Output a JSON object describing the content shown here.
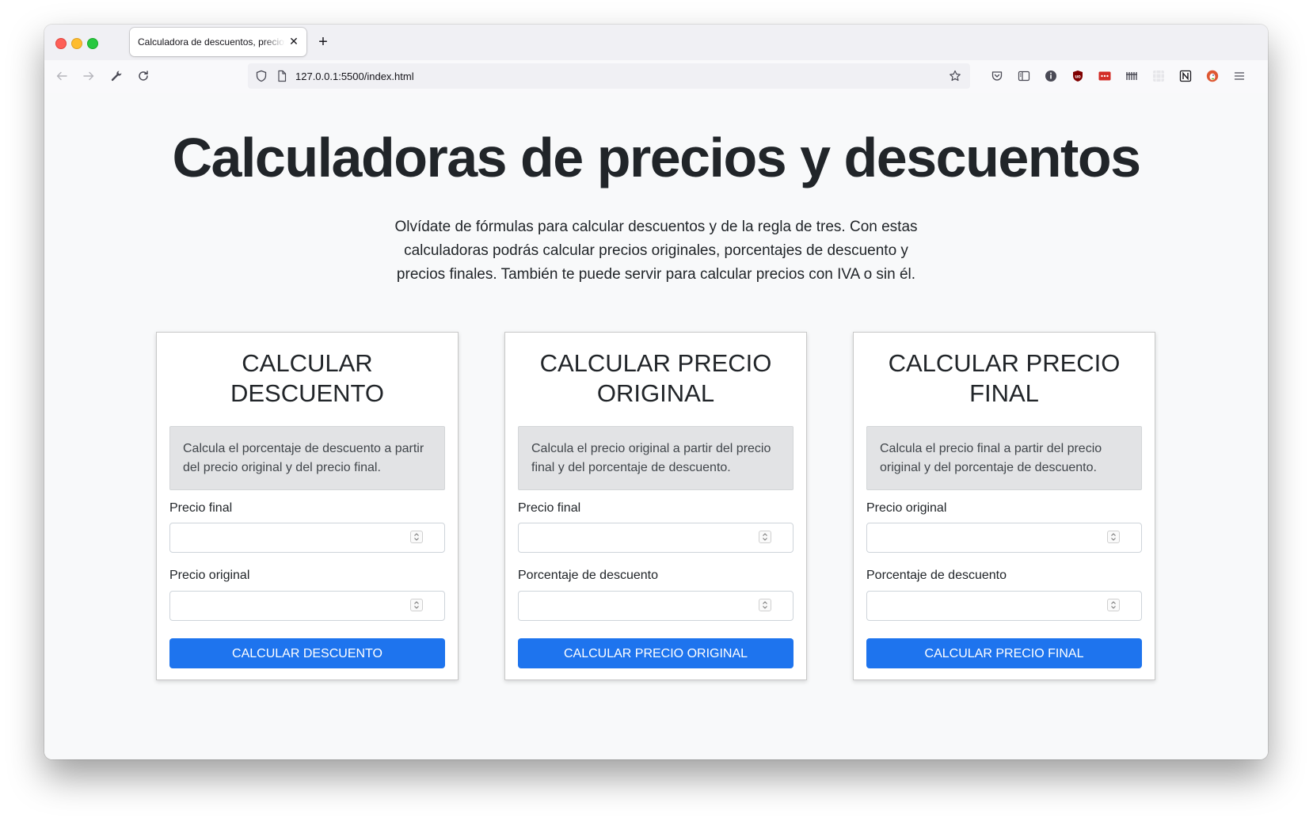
{
  "browser": {
    "tab_title": "Calculadora de descuentos, precios",
    "url": "127.0.0.1:5500/index.html"
  },
  "hero": {
    "title": "Calculadoras de precios y descuentos",
    "lead_lines": [
      "Olvídate de fórmulas para calcular descuentos y de la regla de tres. Con estas",
      "calculadoras podrás calcular precios originales, porcentajes de descuento y",
      "precios finales. También te puede servir para calcular precios con IVA o sin él."
    ]
  },
  "cards": [
    {
      "title_lines": [
        "CALCULAR",
        "DESCUENTO"
      ],
      "description": "Calcula el porcentaje de descuento a partir del precio original y del precio final.",
      "field1_label": "Precio final",
      "field1_value": "",
      "field2_label": "Precio original",
      "field2_value": "",
      "button": "CALCULAR DESCUENTO"
    },
    {
      "title_lines": [
        "CALCULAR PRECIO",
        "ORIGINAL"
      ],
      "description": "Calcula el precio original a partir del precio final y del porcentaje de descuento.",
      "field1_label": "Precio final",
      "field1_value": "",
      "field2_label": "Porcentaje de descuento",
      "field2_value": "",
      "button": "CALCULAR PRECIO ORIGINAL"
    },
    {
      "title_lines": [
        "CALCULAR PRECIO",
        "FINAL"
      ],
      "description": "Calcula el precio final a partir del precio original y del porcentaje de descuento.",
      "field1_label": "Precio original",
      "field1_value": "",
      "field2_label": "Porcentaje de descuento",
      "field2_value": "",
      "button": "CALCULAR PRECIO FINAL"
    }
  ],
  "colors": {
    "primary_button": "#1e74ee",
    "page_background": "#f8f9fa",
    "description_background": "#e2e3e5"
  },
  "icons": {
    "toolbar_left": [
      "back-arrow-icon",
      "forward-arrow-icon",
      "wrench-icon",
      "reload-icon"
    ],
    "url_bar": [
      "shield-icon",
      "page-icon",
      "star-icon"
    ],
    "extensions": [
      "pocket-icon",
      "reader-view-icon",
      "info-icon",
      "ublock-icon",
      "lastpass-icon",
      "bars-icon",
      "grid-extension-icon",
      "notion-icon",
      "duckduckgo-icon",
      "hamburger-menu-icon"
    ]
  }
}
